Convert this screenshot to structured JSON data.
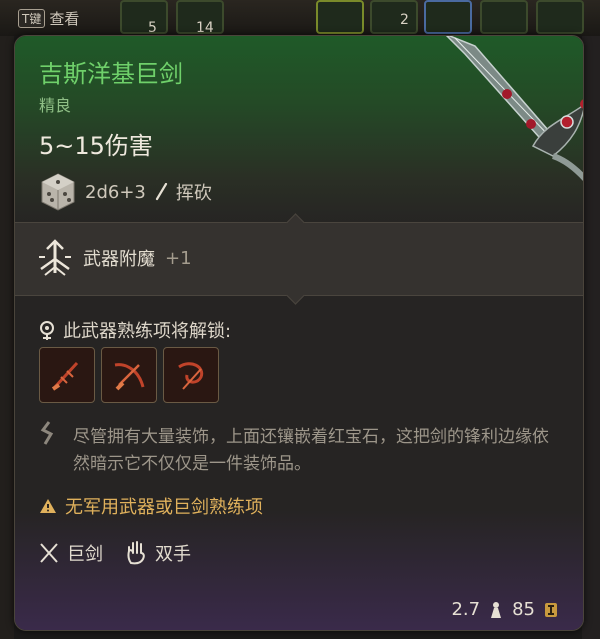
{
  "background": {
    "key_hint": {
      "key": "T键",
      "label": "查看"
    },
    "slot_counts": [
      "5",
      "14",
      "2"
    ]
  },
  "tooltip": {
    "name": "吉斯洋基巨剑",
    "rarity": "精良",
    "damage": "5~15伤害",
    "dice": "2d6+3",
    "damage_type": "挥砍",
    "enchant_label": "武器附魔",
    "enchant_value": "+1",
    "proficiency_title": "此武器熟练项将解锁:",
    "proficiency_icons": [
      "slash-ability-icon",
      "cleave-ability-icon",
      "lacerate-ability-icon"
    ],
    "description": "尽管拥有大量装饰，上面还镶嵌着红宝石，这把剑的锋利边缘依然暗示它不仅仅是一件装饰品。",
    "warning": "无军用武器或巨剑熟练项",
    "tags": [
      {
        "label": "巨剑",
        "icon": "crossed-swords-icon"
      },
      {
        "label": "双手",
        "icon": "hand-icon"
      }
    ],
    "weight": "2.7",
    "price": "85"
  },
  "colors": {
    "name_green": "#6fd06a",
    "warning_orange": "#e0b15c",
    "ability_red": "#c0432a"
  }
}
